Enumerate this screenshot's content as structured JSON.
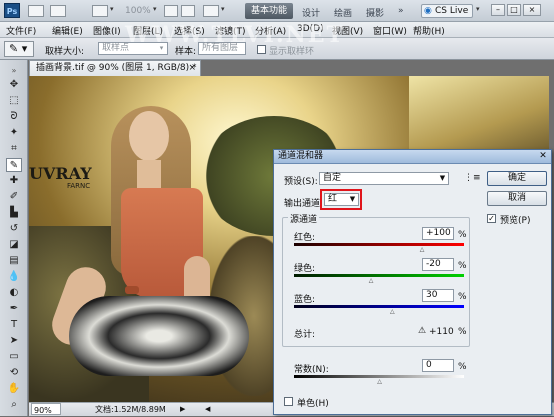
{
  "app": {
    "logo": "Ps",
    "zoom_top": "100%",
    "workspace_active": "基本功能",
    "workspaces": [
      "设计",
      "绘画",
      "摄影"
    ],
    "more": "»",
    "cs_live": "CS Live"
  },
  "menu": [
    "文件(F)",
    "编辑(E)",
    "图像(I)",
    "图层(L)",
    "选择(S)",
    "滤镜(T)",
    "分析(A)",
    "3D(D)",
    "视图(V)",
    "窗口(W)",
    "帮助(H)"
  ],
  "options": {
    "sample_size_label": "取样大小:",
    "sample_size_value": "取样点",
    "sample_label": "样本:",
    "sample_value": "所有图层",
    "show_ring": "显示取样环"
  },
  "watermark": "WWW.TLVI.NET",
  "document": {
    "tab": "插画背景.tif @ 90% (图层 1, RGB/8) *",
    "canvas_text_big": "UVRAY",
    "canvas_text_small": "FARNC",
    "zoom": "90%",
    "doc_info": "文档:1.52M/8.89M"
  },
  "dialog": {
    "title": "通道混和器",
    "preset_label": "预设(S):",
    "preset_value": "自定",
    "output_label": "输出通道:",
    "output_value": "红",
    "source_group": "源通道",
    "red_label": "红色:",
    "red_value": "+100",
    "green_label": "绿色:",
    "green_value": "-20",
    "blue_label": "蓝色:",
    "blue_value": "30",
    "total_label": "总计:",
    "total_value": "+110",
    "constant_label": "常数(N):",
    "constant_value": "0",
    "percent": "%",
    "mono_label": "单色(H)",
    "ok": "确定",
    "cancel": "取消",
    "preview_label": "预览(P)",
    "preview_checked": true,
    "red_value_num": 100,
    "green_value_num": -20,
    "blue_value_num": 30,
    "constant_value_num": 0
  },
  "colors": {
    "highlight": "#e0141b",
    "dialog_bg": "#eaeef2",
    "titlebar": "#9fbbdc"
  }
}
